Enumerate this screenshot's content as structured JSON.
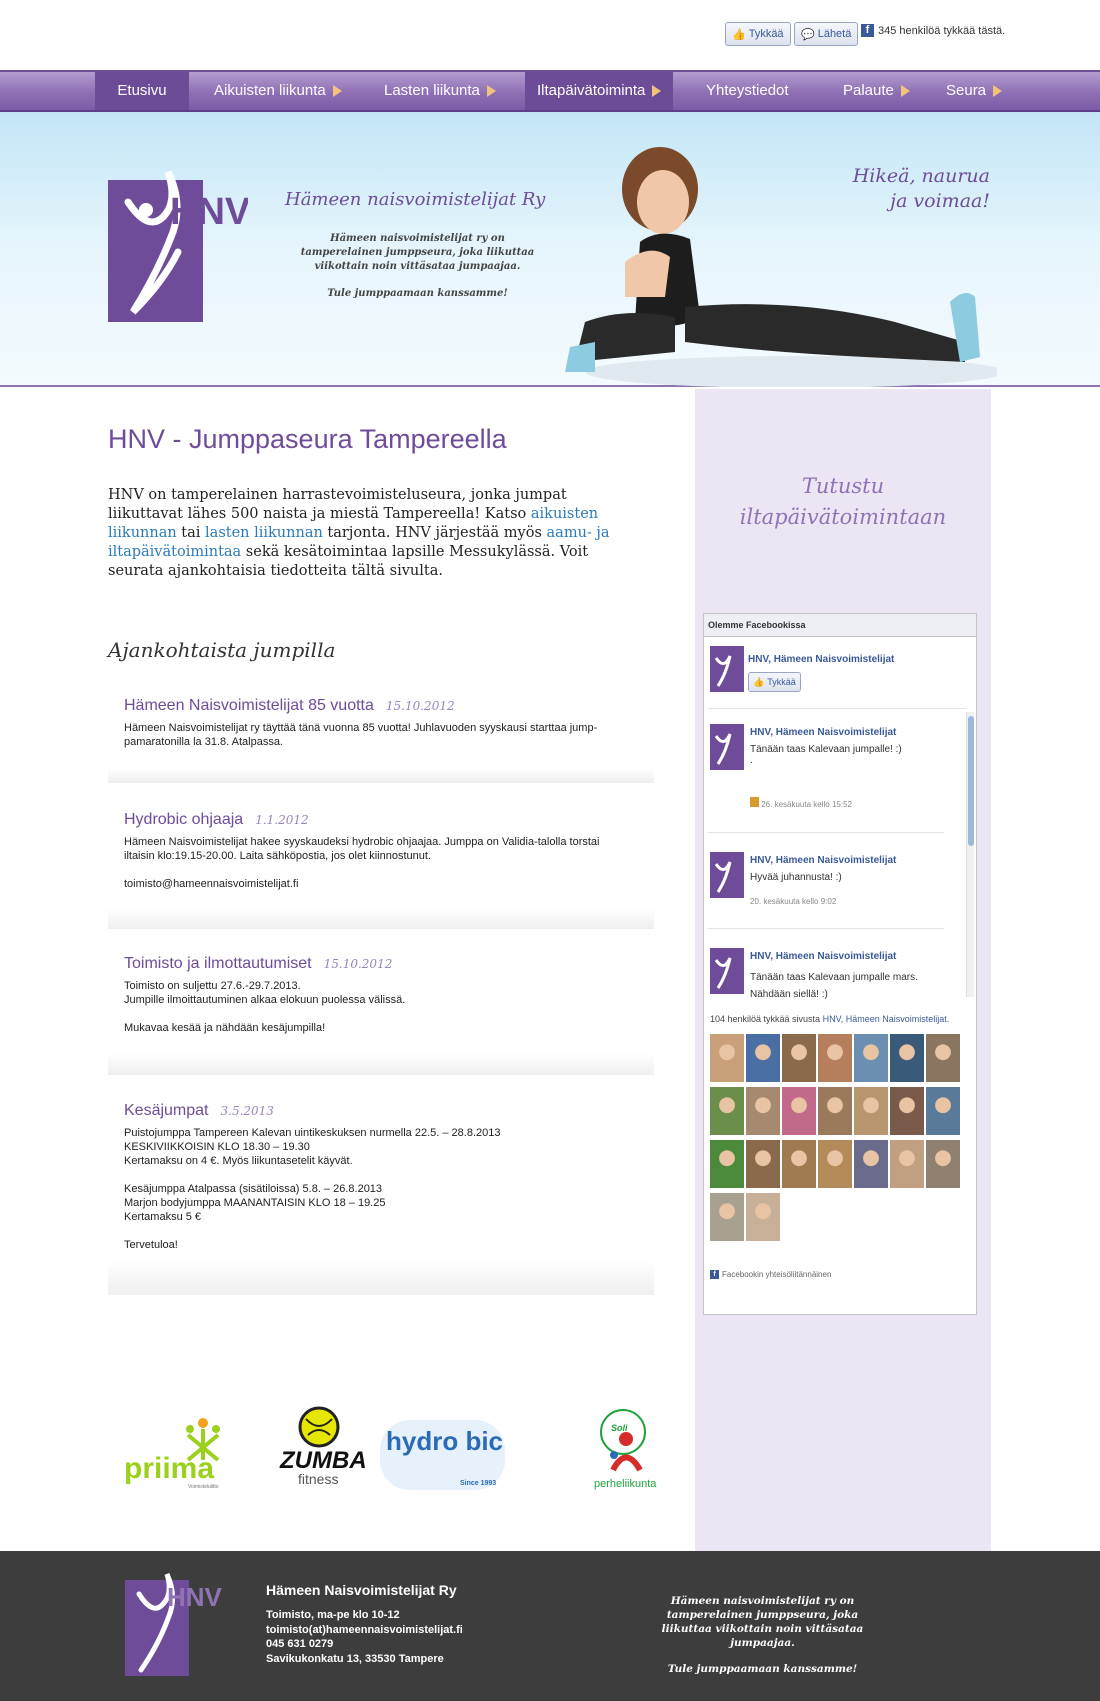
{
  "topbar": {
    "like_button": "Tykkää",
    "send_button": "Lähetä",
    "fb_count": "345 henkilöä tykkää tästä."
  },
  "nav": {
    "items": [
      {
        "label": "Etusivu"
      },
      {
        "label": "Aikuisten liikunta"
      },
      {
        "label": "Lasten liikunta"
      },
      {
        "label": "Iltapäivätoiminta"
      },
      {
        "label": "Yhteystiedot"
      },
      {
        "label": "Palaute"
      },
      {
        "label": "Seura"
      }
    ]
  },
  "hero": {
    "logo_text": "HNV",
    "site_title": "Hämeen naisvoimistelijat Ry",
    "description": "Hämeen naisvoimistelijat ry on tamperelainen jumppseura, joka liikuttaa viikottain noin vittäsataa jumpaajaa.",
    "cta": "Tule jumppaamaan kanssamme!",
    "slogan_line1": "Hikeä, naurua",
    "slogan_line2": "ja voimaa!"
  },
  "main": {
    "title": "HNV - Jumppaseura Tampereella",
    "intro_1": "HNV on tamperelainen harrastevoimisteluseura, jonka jumpat liikuttavat lähes 500 naista ja miestä Tampereella! Katso ",
    "intro_link1": "aikuisten liikunnan",
    "intro_2": " tai ",
    "intro_link2": "lasten liikunnan",
    "intro_3": " tarjonta. HNV järjestää myös ",
    "intro_link3": "aamu- ja iltapäivätoimintaa",
    "intro_4": " sekä kesätoimintaa lapsille Messukylässä. Voit seurata ajankohtaisia tiedotteita tältä sivulta.",
    "news_heading": "Ajankohtaista jumpilla",
    "news": [
      {
        "title": "Hämeen Naisvoimistelijat 85 vuotta",
        "date": "15.10.2012",
        "body": "Hämeen Naisvoimistelijat ry täyttää tänä vuonna 85 vuotta! Juhlavuoden syyskausi starttaa jump-\npamaratonilla la 31.8. Atalpassa."
      },
      {
        "title": "Hydrobic ohjaaja",
        "date": "1.1.2012",
        "body": "Hämeen Naisvoimistelijat hakee syyskaudeksi hydrobic ohjaajaa. Jumppa on Validia-talolla torstai\niltaisin klo:19.15-20.00. Laita sähköpostia, jos olet kiinnostunut.\n\ntoimisto@hameennaisvoimistelijat.fi"
      },
      {
        "title": "Toimisto ja ilmottautumiset",
        "date": "15.10.2012",
        "body": "Toimisto on suljettu 27.6.-29.7.2013.\nJumpille ilmoittautuminen alkaa elokuun puolessa välissä.\n\nMukavaa kesää ja nähdään kesäjumpilla!"
      },
      {
        "title": "Kesäjumpat",
        "date": "3.5.2013",
        "body": "Puistojumppa Tampereen Kalevan uintikeskuksen nurmella 22.5. – 28.8.2013\nKESKIVIIKKOISIN KLO 18.30 – 19.30\nKertamaksu on 4 €. Myös liikuntasetelit käyvät.\n\nKesäjumppa Atalpassa (sisätiloissa) 5.8. – 26.8.2013\nMarjon bodyjumppa MAANANTAISIN KLO 18 – 19.25\nKertamaksu 5 €\n\nTervetuloa!"
      }
    ]
  },
  "sidebar": {
    "title_line1": "Tutustu",
    "title_line2": "iltapäivätoimintaan",
    "fb_box": {
      "header": "Olemme Facebookissa",
      "page_name": "HNV, Hämeen Naisvoimistelijat",
      "like_label": "Tykkää",
      "posts": [
        {
          "author": "HNV, Hämeen Naisvoimistelijat",
          "text": "Tänään taas Kalevaan jumpalle! :)",
          "extra": ".",
          "time": "26. kesäkuuta kello 15:52"
        },
        {
          "author": "HNV, Hämeen Naisvoimistelijat",
          "text": "Hyvää juhannusta! :)",
          "time": "20. kesäkuuta kello 9:02"
        },
        {
          "author": "HNV, Hämeen Naisvoimistelijat",
          "text": "Tänään taas Kalevaan jumpalle mars.\nNähdään siellä! :)",
          "time": ""
        }
      ],
      "likes_prefix": "104 henkilöä tykkää sivusta ",
      "likes_page": "HNV, Hämeen Naisvoimistelijat.",
      "footer": "Facebookin yhteisöliitännäinen"
    }
  },
  "sponsors": [
    {
      "name": "priima",
      "sub": "Voimistelulitto"
    },
    {
      "name": "ZUMBA",
      "sub": "fitness"
    },
    {
      "name": "hydro bic",
      "sub": "Since 1993"
    },
    {
      "name": "Soli",
      "sub": "perheliikunta"
    }
  ],
  "footer": {
    "logo_text": "HNV",
    "org_name": "Hämeen Naisvoimistelijat Ry",
    "office_hours": "Toimisto, ma-pe klo 10-12",
    "email": "toimisto(at)hameennaisvoimistelijat.fi",
    "phone": "045 631 0279",
    "address": "Savikukonkatu 13, 33530 Tampere",
    "description": "Hämeen naisvoimistelijat ry on tamperelainen jumppseura, joka liikuttaa viikottain noin vittäsataa jumpaajaa.",
    "cta": "Tule jumppaamaan kanssamme!"
  },
  "colors": {
    "brand_purple": "#6f4c99",
    "nav_purple": "#8e6fb4",
    "link_blue": "#2c7bb6",
    "facebook_blue": "#3b5998",
    "footer_bg": "#3d3d3d",
    "sidebar_bg": "#ece6f4"
  }
}
